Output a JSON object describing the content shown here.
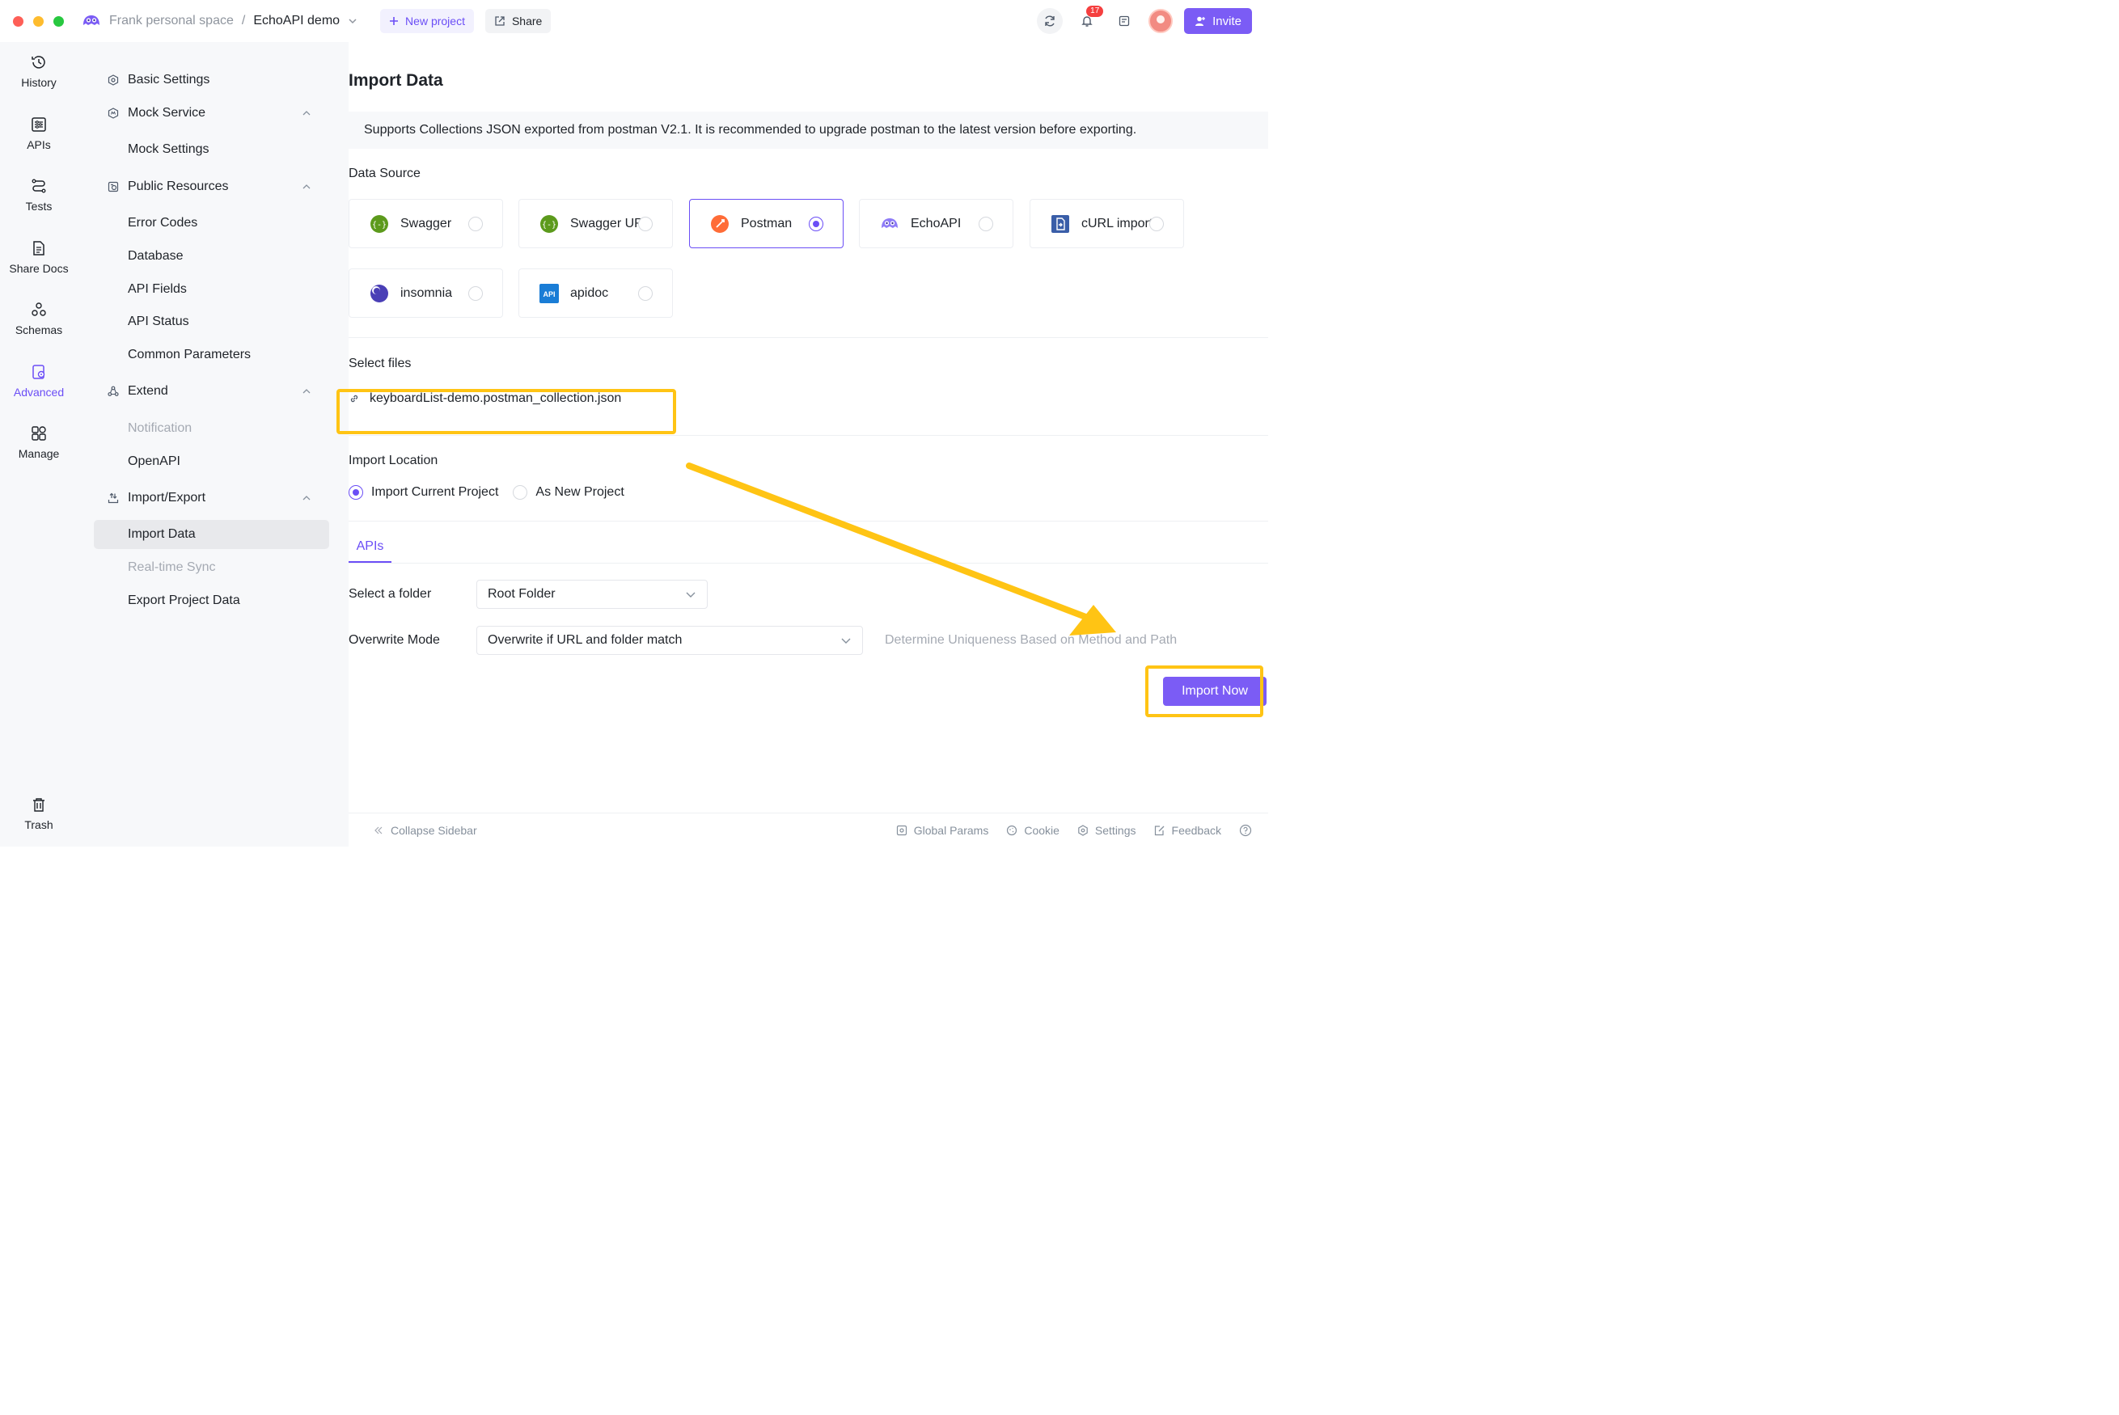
{
  "topbar": {
    "workspace": "Frank personal space",
    "separator": "/",
    "project": "EchoAPI demo",
    "new_project": "New project",
    "share": "Share",
    "notifications_count": "17",
    "invite": "Invite"
  },
  "rail": {
    "items": [
      {
        "label": "History",
        "icon": "history-icon"
      },
      {
        "label": "APIs",
        "icon": "apis-icon"
      },
      {
        "label": "Tests",
        "icon": "tests-icon"
      },
      {
        "label": "Share Docs",
        "icon": "share-docs-icon"
      },
      {
        "label": "Schemas",
        "icon": "schemas-icon"
      },
      {
        "label": "Advanced",
        "icon": "advanced-icon"
      },
      {
        "label": "Manage",
        "icon": "manage-icon"
      },
      {
        "label": "Trash",
        "icon": "trash-icon"
      }
    ],
    "active": "Advanced"
  },
  "sidebar": {
    "basic_settings": "Basic Settings",
    "mock_service": "Mock Service",
    "mock_settings": "Mock Settings",
    "public_resources": "Public Resources",
    "error_codes": "Error Codes",
    "database": "Database",
    "api_fields": "API Fields",
    "api_status": "API Status",
    "common_parameters": "Common Parameters",
    "extend": "Extend",
    "notification": "Notification",
    "openapi": "OpenAPI",
    "import_export": "Import/Export",
    "import_data": "Import Data",
    "realtime_sync": "Real-time Sync",
    "export_project_data": "Export Project Data"
  },
  "main": {
    "title": "Import Data",
    "info": "Supports Collections JSON exported from postman V2.1. It is recommended to upgrade postman to the latest version before exporting.",
    "data_source_label": "Data Source",
    "sources": [
      {
        "name": "Swagger",
        "icon": "swagger-icon",
        "selected": false
      },
      {
        "name": "Swagger URL",
        "icon": "swagger-url-icon",
        "selected": false
      },
      {
        "name": "Postman",
        "icon": "postman-icon",
        "selected": true
      },
      {
        "name": "EchoAPI",
        "icon": "echoapi-icon",
        "selected": false
      },
      {
        "name": "cURL import",
        "icon": "curl-icon",
        "selected": false
      },
      {
        "name": "insomnia",
        "icon": "insomnia-icon",
        "selected": false
      },
      {
        "name": "apidoc",
        "icon": "apidoc-icon",
        "selected": false
      }
    ],
    "apidoc_badge": "API",
    "select_files_label": "Select files",
    "file_name": "keyboardList-demo.postman_collection.json",
    "import_location_label": "Import Location",
    "location_options": [
      {
        "label": "Import Current Project",
        "selected": true
      },
      {
        "label": "As New Project",
        "selected": false
      }
    ],
    "tab": "APIs",
    "select_folder_label": "Select a folder",
    "folder_value": "Root Folder",
    "overwrite_label": "Overwrite Mode",
    "overwrite_value": "Overwrite if URL and folder match",
    "hint": "Determine Uniqueness Based on Method and Path",
    "import_button": "Import Now"
  },
  "footer": {
    "collapse": "Collapse Sidebar",
    "global_params": "Global Params",
    "cookie": "Cookie",
    "settings": "Settings",
    "feedback": "Feedback"
  },
  "colors": {
    "accent": "#7b5cf5",
    "highlight": "#ffc414"
  }
}
